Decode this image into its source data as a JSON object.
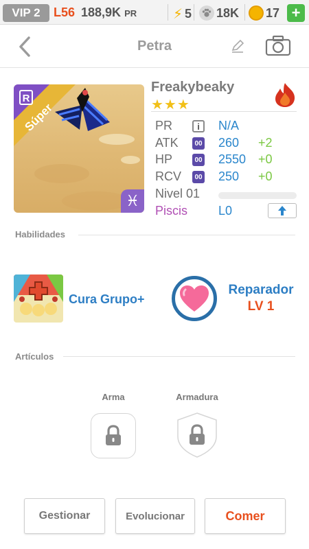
{
  "status_bar": {
    "vip": "VIP 2",
    "level": "L56",
    "power": "188,9K",
    "power_unit": "PR",
    "energy": "5",
    "paws": "18K",
    "coins": "17",
    "add_label": "+"
  },
  "nav": {
    "title": "Petra"
  },
  "monster": {
    "name": "Freakybeaky",
    "stars": "★★★",
    "rank_label": "Súper",
    "rank_badge": "R",
    "element_icon": "fire-icon",
    "sign_symbol": "♓",
    "stats": [
      {
        "label": "PR",
        "value": "N/A",
        "bonus": ""
      },
      {
        "label": "ATK",
        "value": "260",
        "bonus": "+2"
      },
      {
        "label": "HP",
        "value": "2550",
        "bonus": "+0"
      },
      {
        "label": "RCV",
        "value": "250",
        "bonus": "+0"
      }
    ],
    "level_label": "Nivel 01",
    "level_progress": 0,
    "sign_label": "Piscis",
    "sign_level": "L0",
    "stat_icon_text": "00",
    "info_icon_text": "i"
  },
  "abilities": {
    "title": "Habilidades",
    "skill_name": "Cura Grupo+",
    "awakening_name": "Reparador",
    "awakening_level": "LV 1"
  },
  "items": {
    "title": "Artículos",
    "weapon_label": "Arma",
    "armor_label": "Armadura"
  },
  "buttons": {
    "manage": "Gestionar",
    "evolve": "Evolucionar",
    "eat": "Comer"
  },
  "colors": {
    "accent_orange": "#e8501e",
    "accent_blue": "#2a86cc",
    "bonus_green": "#7bc843",
    "sign_purple": "#b04fb4"
  }
}
